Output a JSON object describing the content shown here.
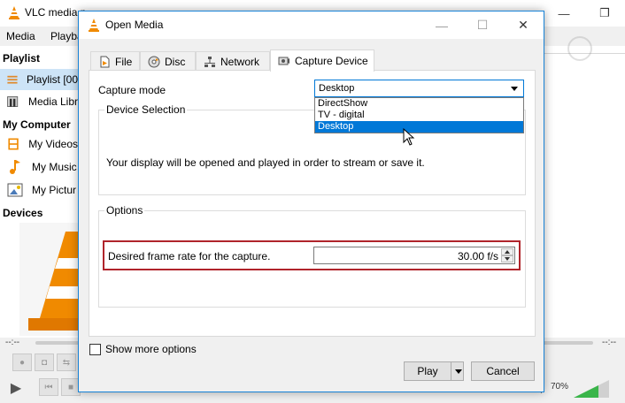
{
  "vlc": {
    "title": "VLC media p",
    "menu": [
      "Media",
      "Playba"
    ],
    "sidebar": {
      "playlist_heading": "Playlist",
      "playlist_items": [
        {
          "label": "Playlist [00",
          "icon": "playlist-icon"
        },
        {
          "label": "Media Libr",
          "icon": "media-library-icon"
        }
      ],
      "my_computer_heading": "My Computer",
      "my_computer_items": [
        {
          "label": "My Videos",
          "icon": "film-icon"
        },
        {
          "label": "My Music",
          "icon": "music-note-icon"
        },
        {
          "label": "My Pictur",
          "icon": "picture-icon"
        }
      ],
      "devices_heading": "Devices"
    },
    "time_left": "--:--",
    "time_right": "--:--",
    "volume": "70%",
    "volume_level": 0.7
  },
  "dialog": {
    "title": "Open Media",
    "tabs": [
      {
        "label": "File",
        "icon": "file-icon"
      },
      {
        "label": "Disc",
        "icon": "disc-icon"
      },
      {
        "label": "Network",
        "icon": "network-icon"
      },
      {
        "label": "Capture Device",
        "icon": "capture-device-icon"
      }
    ],
    "active_tab": "Capture Device",
    "capture_mode_label": "Capture mode",
    "capture_mode_value": "Desktop",
    "capture_mode_options": [
      "DirectShow",
      "TV - digital",
      "Desktop"
    ],
    "device_selection_title": "Device Selection",
    "device_selection_text": "Your display will be opened and played in order to stream or save it.",
    "options_title": "Options",
    "frame_rate_label": "Desired frame rate for the capture.",
    "frame_rate_value": "30.00 f/s",
    "show_more_options": "Show more options",
    "play_button": "Play",
    "cancel_button": "Cancel"
  },
  "colors": {
    "accent": "#0078d7",
    "highlight_border": "#b0242b",
    "vlc_orange": "#f08a00"
  }
}
